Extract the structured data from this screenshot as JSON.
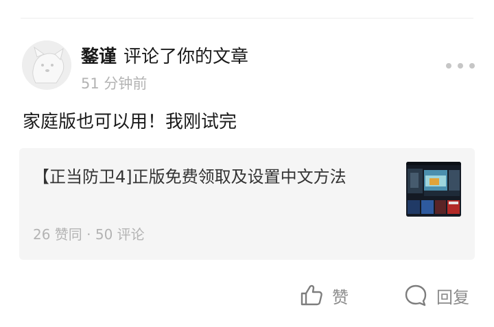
{
  "notification": {
    "username": "鍪谨",
    "action_text": "评论了你的文章",
    "timestamp": "51 分钟前",
    "comment": "家庭版也可以用！我刚试完"
  },
  "article": {
    "title": "【正当防卫4]正版免费领取及设置中文方法",
    "stats": "26 赞同 · 50 评论"
  },
  "actions": {
    "like_label": "赞",
    "reply_label": "回复"
  },
  "icons": {
    "avatar": "cartoon-dog-avatar",
    "more": "more-dots-icon",
    "like": "thumbs-up-icon",
    "reply": "speech-bubble-icon"
  },
  "colors": {
    "primary_text": "#1a1a1a",
    "secondary_text": "#b3b3b3",
    "card_background": "#f5f5f5",
    "action_gray": "#8a8a8a"
  }
}
